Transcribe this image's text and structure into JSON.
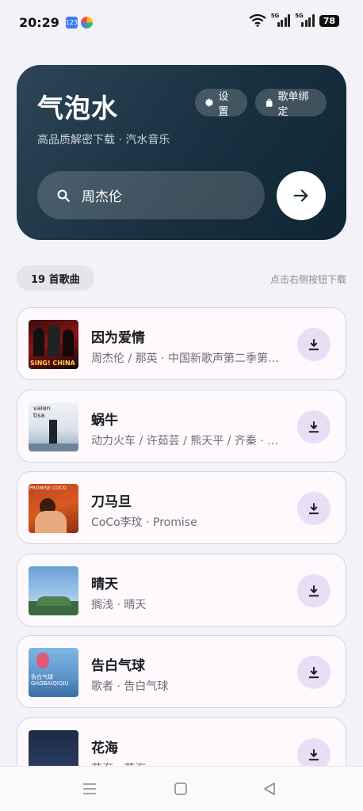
{
  "status_bar": {
    "time": "20:29",
    "mini_icon_text": "123",
    "signal_label_1": "5G",
    "signal_label_2": "5G",
    "battery": "78"
  },
  "header": {
    "title": "气泡水",
    "subtitle": "高品质解密下载 · 汽水音乐",
    "settings_label": "设置",
    "playlist_bind_label": "歌单绑定",
    "search_value": "周杰伦"
  },
  "list_header": {
    "count_label": "19 首歌曲",
    "hint": "点击右侧按钮下载"
  },
  "songs": [
    {
      "title": "因为爱情",
      "subtitle": "周杰伦 / 那英 · 中国新歌声第二季第一期",
      "cover_text": "SING! CHINA"
    },
    {
      "title": "蜗牛",
      "subtitle": "动力火车 / 许茹芸 / 熊天平 / 齐秦 · 周杰伦",
      "cover_text": "valen tisa"
    },
    {
      "title": "刀马旦",
      "subtitle": "CoCo李玟 · Promise",
      "cover_text": "PROMISE COCO"
    },
    {
      "title": "晴天",
      "subtitle": "搁浅 · 晴天",
      "cover_text": ""
    },
    {
      "title": "告白气球",
      "subtitle": "歌者 · 告白气球",
      "cover_text": "告白气球 GAOBAIQIQIU"
    },
    {
      "title": "花海",
      "subtitle": "花海 · 花海",
      "cover_text": ""
    }
  ],
  "colors": {
    "header_bg": "#18303f",
    "download_bg": "#e9def6",
    "card_border": "#d6d2de"
  }
}
